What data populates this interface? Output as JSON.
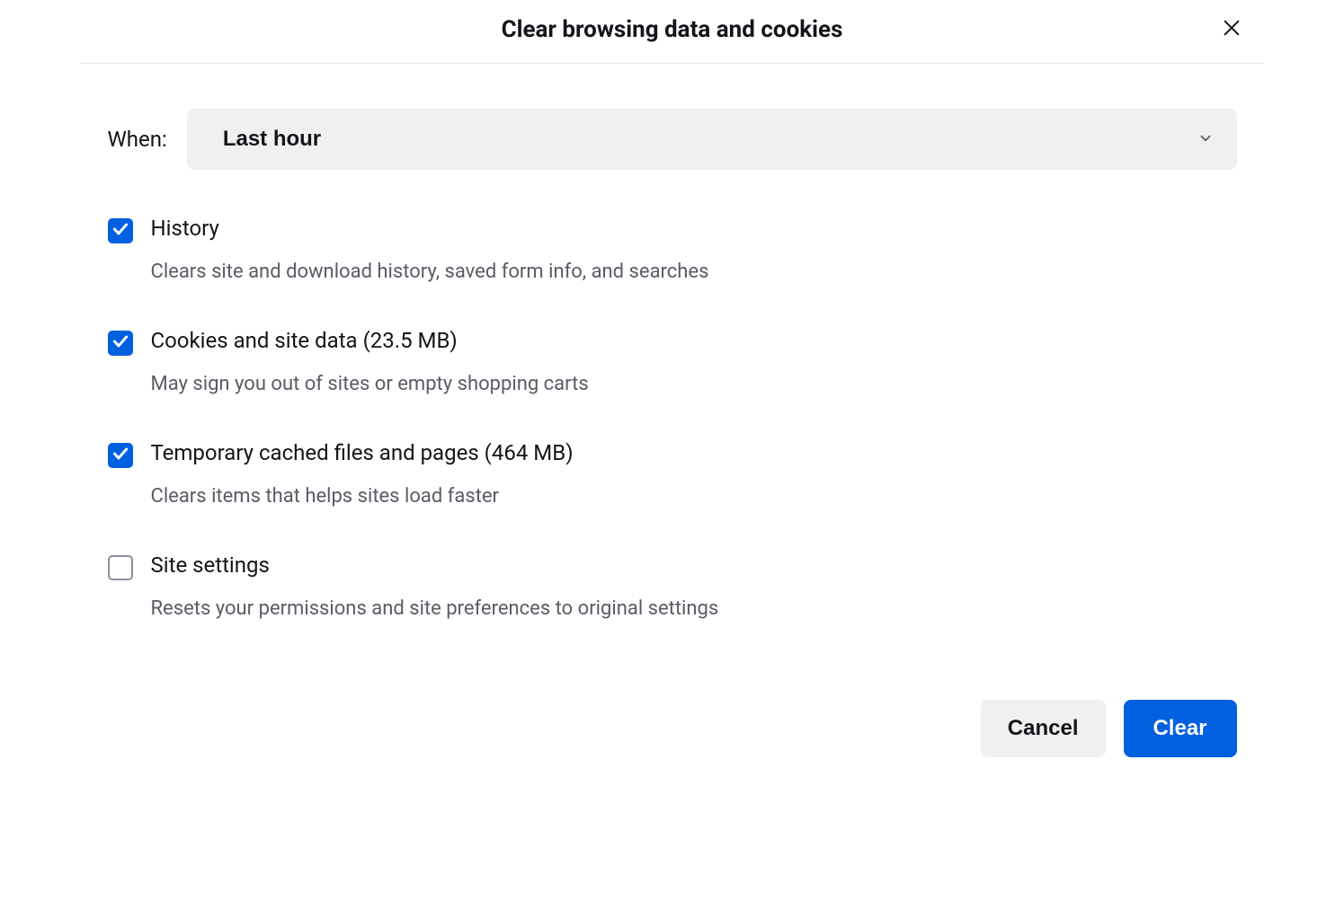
{
  "dialog": {
    "title": "Clear browsing data and cookies"
  },
  "when": {
    "label": "When:",
    "value": "Last hour"
  },
  "options": [
    {
      "title": "History",
      "desc": "Clears site and download history, saved form info, and searches",
      "checked": true
    },
    {
      "title": "Cookies and site data (23.5 MB)",
      "desc": "May sign you out of sites or empty shopping carts",
      "checked": true
    },
    {
      "title": "Temporary cached files and pages (464 MB)",
      "desc": "Clears items that helps sites load faster",
      "checked": true
    },
    {
      "title": "Site settings",
      "desc": "Resets your permissions and site preferences to original settings",
      "checked": false
    }
  ],
  "footer": {
    "cancel": "Cancel",
    "clear": "Clear"
  }
}
